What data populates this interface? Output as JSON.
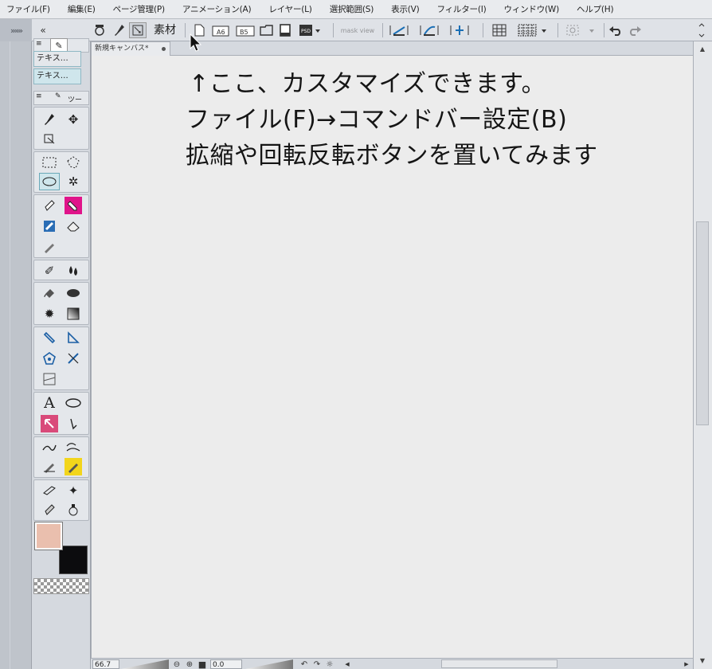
{
  "menu": [
    "ファイル(F)",
    "編集(E)",
    "ページ管理(P)",
    "アニメーション(A)",
    "レイヤー(L)",
    "選択範囲(S)",
    "表示(V)",
    "フィルター(I)",
    "ウィンドウ(W)",
    "ヘルプ(H)"
  ],
  "command_bar": {
    "grip": "»»»",
    "material_label": "素材",
    "mask_label": "mask view"
  },
  "tool_panel": {
    "subtool_1": "テキス…",
    "subtool_2": "テキス…",
    "tab_label": "ツール"
  },
  "colors": {
    "main": "#eabfae",
    "sub": "#0c0c0e",
    "accent": "#cfe6ec"
  },
  "document": {
    "tab_title": "新規キャンバス*"
  },
  "canvas_note": {
    "line1": "↑ここ、カスタマイズできます。",
    "line2": "ファイル(F)→コマンドバー設定(B)",
    "line3": "拡縮や回転反転ボタンを置いてみます"
  },
  "status": {
    "zoom": "66.7",
    "rotation": "0.0"
  }
}
